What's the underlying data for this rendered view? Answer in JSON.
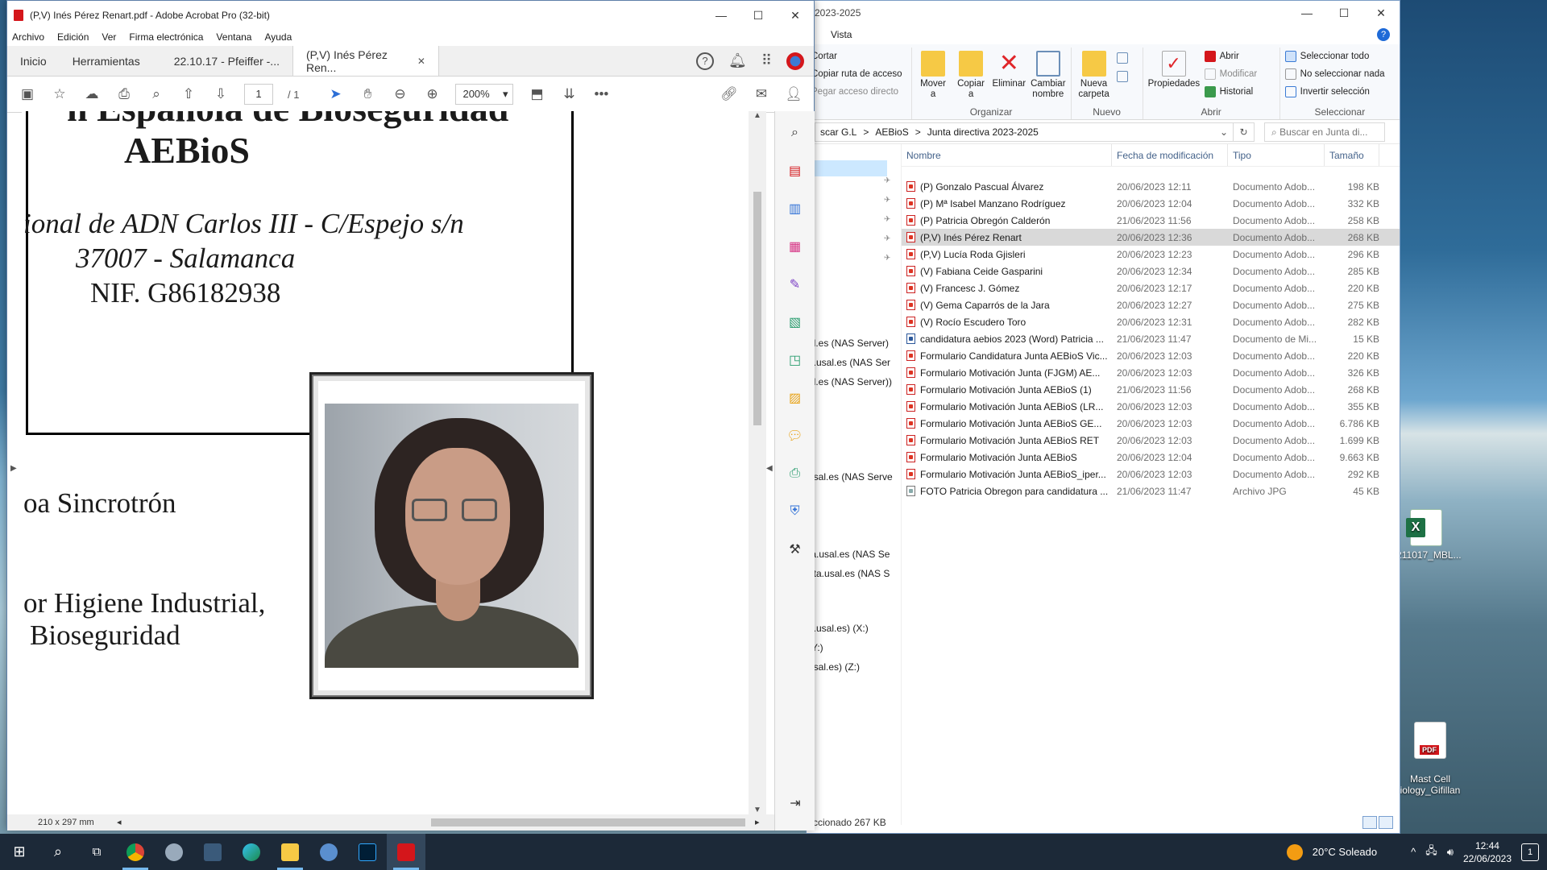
{
  "desktop": {
    "icons": [
      {
        "label": "0211017_MBL..."
      },
      {
        "label": "Mast Cell\niology_Gifillan"
      }
    ]
  },
  "explorer": {
    "title": "2023-2025",
    "menu_tabs": [
      "Vista"
    ],
    "help": "?",
    "ribbon": {
      "portapapeles": {
        "cortar": "Cortar",
        "copiar_ruta": "Copiar ruta de acceso",
        "pegar_acceso": "Pegar acceso directo"
      },
      "organizar": {
        "label": "Organizar",
        "mover": "Mover\na",
        "copiar": "Copiar\na",
        "eliminar": "Eliminar",
        "cambiar": "Cambiar\nnombre"
      },
      "nuevo": {
        "label": "Nuevo",
        "nueva_carpeta": "Nueva\ncarpeta"
      },
      "abrir": {
        "label": "Abrir",
        "propiedades": "Propiedades",
        "abrir": "Abrir",
        "modificar": "Modificar",
        "historial": "Historial"
      },
      "seleccionar": {
        "label": "Seleccionar",
        "todo": "Seleccionar todo",
        "nada": "No seleccionar nada",
        "invertir": "Invertir selección"
      }
    },
    "breadcrumb": [
      "scar G.L",
      ">",
      "AEBioS",
      ">",
      "Junta directiva 2023-2025"
    ],
    "search_placeholder": "Buscar en Junta di...",
    "columns": [
      "Nombre",
      "Fecha de modificación",
      "Tipo",
      "Tamaño"
    ],
    "nav_items": [
      "al.es (NAS Server)",
      "a.usal.es (NAS Ser",
      "al.es (NAS Server))",
      "usal.es (NAS Serve",
      "ta.usal.es (NAS Se",
      "ata.usal.es (NAS S",
      "a.usal.es) (X:)",
      "(Y:)",
      "usal.es) (Z:)"
    ],
    "files": [
      {
        "name": "(P) Gonzalo Pascual Álvarez",
        "date": "20/06/2023 12:11",
        "type": "Documento Adob...",
        "size": "198 KB",
        "kind": "pdf"
      },
      {
        "name": "(P) Mª Isabel Manzano Rodríguez",
        "date": "20/06/2023 12:04",
        "type": "Documento Adob...",
        "size": "332 KB",
        "kind": "pdf"
      },
      {
        "name": "(P) Patricia Obregón Calderón",
        "date": "21/06/2023 11:56",
        "type": "Documento Adob...",
        "size": "258 KB",
        "kind": "pdf"
      },
      {
        "name": "(P,V) Inés Pérez Renart",
        "date": "20/06/2023 12:36",
        "type": "Documento Adob...",
        "size": "268 KB",
        "kind": "pdf"
      },
      {
        "name": "(P,V) Lucía Roda Gjisleri",
        "date": "20/06/2023 12:23",
        "type": "Documento Adob...",
        "size": "296 KB",
        "kind": "pdf"
      },
      {
        "name": "(V) Fabiana Ceide Gasparini",
        "date": "20/06/2023 12:34",
        "type": "Documento Adob...",
        "size": "285 KB",
        "kind": "pdf"
      },
      {
        "name": "(V) Francesc J. Gómez",
        "date": "20/06/2023 12:17",
        "type": "Documento Adob...",
        "size": "220 KB",
        "kind": "pdf"
      },
      {
        "name": "(V) Gema Caparrós de la Jara",
        "date": "20/06/2023 12:27",
        "type": "Documento Adob...",
        "size": "275 KB",
        "kind": "pdf"
      },
      {
        "name": "(V) Rocío Escudero Toro",
        "date": "20/06/2023 12:31",
        "type": "Documento Adob...",
        "size": "282 KB",
        "kind": "pdf"
      },
      {
        "name": "candidatura aebios 2023 (Word) Patricia ...",
        "date": "21/06/2023 11:47",
        "type": "Documento de Mi...",
        "size": "15 KB",
        "kind": "word"
      },
      {
        "name": "Formulario Candidatura Junta AEBioS Vic...",
        "date": "20/06/2023 12:03",
        "type": "Documento Adob...",
        "size": "220 KB",
        "kind": "pdf"
      },
      {
        "name": "Formulario Motivación Junta  (FJGM) AE...",
        "date": "20/06/2023 12:03",
        "type": "Documento Adob...",
        "size": "326 KB",
        "kind": "pdf"
      },
      {
        "name": "Formulario Motivación Junta AEBioS (1)",
        "date": "21/06/2023 11:56",
        "type": "Documento Adob...",
        "size": "268 KB",
        "kind": "pdf"
      },
      {
        "name": "Formulario Motivación Junta AEBioS (LR...",
        "date": "20/06/2023 12:03",
        "type": "Documento Adob...",
        "size": "355 KB",
        "kind": "pdf"
      },
      {
        "name": "Formulario Motivación Junta AEBioS GE...",
        "date": "20/06/2023 12:03",
        "type": "Documento Adob...",
        "size": "6.786 KB",
        "kind": "pdf"
      },
      {
        "name": "Formulario Motivación Junta AEBioS RET",
        "date": "20/06/2023 12:03",
        "type": "Documento Adob...",
        "size": "1.699 KB",
        "kind": "pdf"
      },
      {
        "name": "Formulario Motivación Junta AEBioS",
        "date": "20/06/2023 12:04",
        "type": "Documento Adob...",
        "size": "9.663 KB",
        "kind": "pdf"
      },
      {
        "name": "Formulario Motivación Junta AEBioS_iper...",
        "date": "20/06/2023 12:03",
        "type": "Documento Adob...",
        "size": "292 KB",
        "kind": "pdf"
      },
      {
        "name": "FOTO Patricia Obregon para candidatura ...",
        "date": "21/06/2023 11:47",
        "type": "Archivo JPG",
        "size": "45 KB",
        "kind": "jpg"
      }
    ],
    "status": "ccionado  267 KB"
  },
  "acrobat": {
    "title": "(P,V) Inés Pérez Renart.pdf - Adobe Acrobat Pro (32-bit)",
    "menu": [
      "Archivo",
      "Edición",
      "Ver",
      "Firma electrónica",
      "Ventana",
      "Ayuda"
    ],
    "tabs": {
      "inicio": "Inicio",
      "herramientas": "Herramientas",
      "doc1": "22.10.17 - Pfeiffer -...",
      "doc2": "(P,V) Inés Pérez Ren..."
    },
    "toolbar": {
      "page_current": "1",
      "page_total": "/ 1",
      "zoom": "200%"
    },
    "page_size": "210 x 297 mm",
    "document": {
      "org_line1": "n Española de Bioseguridad",
      "org_line2": "AEBioS",
      "address": "ional de ADN Carlos III - C/Espejo s/n",
      "city": "37007 - Salamanca",
      "nif": "NIF. G86182938",
      "text1": "oa Sincrotrón",
      "text2": "or Higiene Industrial,",
      "text3": "Bioseguridad"
    }
  },
  "taskbar": {
    "weather": "20°C  Soleado",
    "time": "12:44",
    "date": "22/06/2023",
    "notifications": "1"
  }
}
